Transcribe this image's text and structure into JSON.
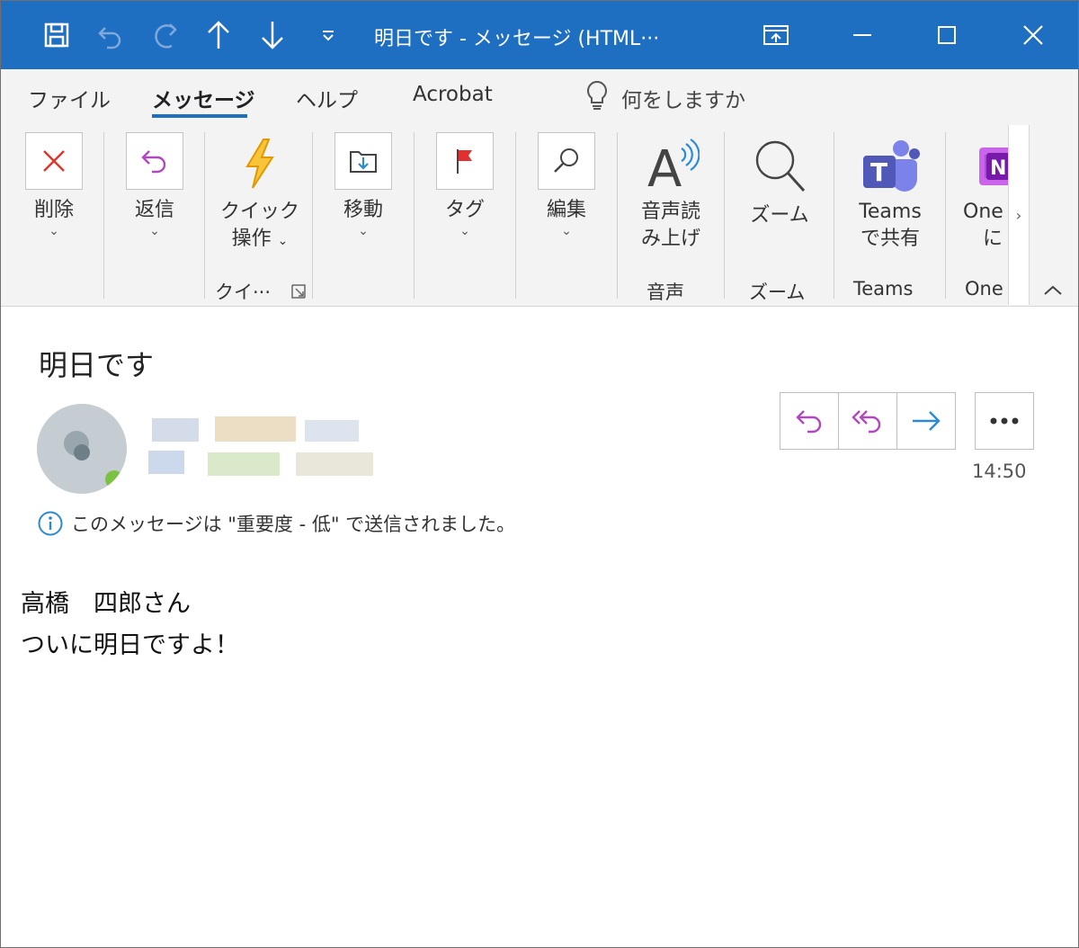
{
  "titlebar": {
    "title": "明日です  -  メッセージ (HTML···",
    "icons": [
      "save-icon",
      "undo-icon",
      "redo-icon",
      "arrow-up-icon",
      "arrow-down-icon",
      "customize-qat-icon",
      "ribbon-display-icon",
      "minimize-icon",
      "maximize-icon",
      "close-icon"
    ]
  },
  "menu": {
    "tabs": [
      "ファイル",
      "メッセージ",
      "ヘルプ",
      "Acrobat"
    ],
    "active_tab": "メッセージ",
    "tell_me": "何をしますか"
  },
  "ribbon": {
    "buttons": {
      "delete": "削除",
      "reply": "返信",
      "quick_steps_1": "クイック",
      "quick_steps_2": "操作",
      "move": "移動",
      "tag": "タグ",
      "edit": "編集",
      "read_aloud_1": "音声読",
      "read_aloud_2": "み上げ",
      "zoom": "ズーム",
      "teams_1": "Teams",
      "teams_2": "で共有",
      "onenote_1": "One",
      "onenote_2": "に"
    },
    "groups": {
      "quick": "クイ···",
      "speech": "音声",
      "zoom": "ズーム",
      "teams": "Teams",
      "onenote": "One"
    }
  },
  "message": {
    "subject": "明日です",
    "time": "14:50",
    "info": "このメッセージは \"重要度 - 低\" で送信されました。",
    "body": [
      "高橋　四郎さん",
      "ついに明日ですよ！"
    ]
  },
  "colors": {
    "titlebar": "#1e6ec2",
    "accent_purple": "#b048c0",
    "forward_blue": "#2b8ad6",
    "delete_red": "#e0342a",
    "flag_red": "#e03030",
    "quick_yellow": "#f0b400",
    "teams_purple": "#5058b8",
    "onenote_purple": "#7719aa"
  }
}
